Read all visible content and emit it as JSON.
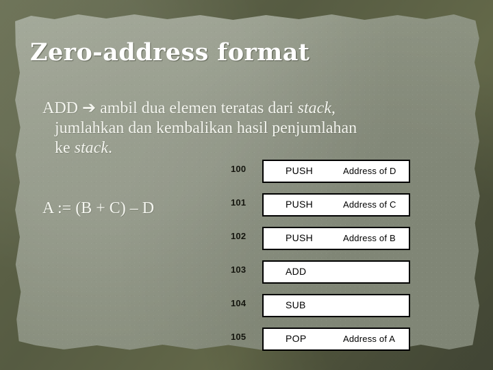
{
  "slide": {
    "title": "Zero-address format",
    "body": {
      "line1": "ADD ➔ ambil dua elemen teratas dari ",
      "italic1": "stack",
      "line1_tail": ",",
      "line2": "jumlahkan dan kembalikan hasil penjumlahan",
      "line3_head": "ke ",
      "italic2": "stack",
      "line3_tail": "."
    },
    "expression": "A := (B + C) – D",
    "colors": {
      "border": "#5d6249",
      "paper": "#8d9382",
      "title_text": "#ffffff",
      "body_text": "#f4f5ef",
      "box_fill": "#ffffff",
      "box_border": "#000000",
      "address_text": "#15160f"
    }
  },
  "program": {
    "rows": [
      {
        "address": "100",
        "opcode": "PUSH",
        "operand": "Address of  D"
      },
      {
        "address": "101",
        "opcode": "PUSH",
        "operand": "Address of  C"
      },
      {
        "address": "102",
        "opcode": "PUSH",
        "operand": "Address of  B"
      },
      {
        "address": "103",
        "opcode": "ADD",
        "operand": ""
      },
      {
        "address": "104",
        "opcode": "SUB",
        "operand": ""
      },
      {
        "address": "105",
        "opcode": "POP",
        "operand": "Address of  A"
      }
    ]
  }
}
